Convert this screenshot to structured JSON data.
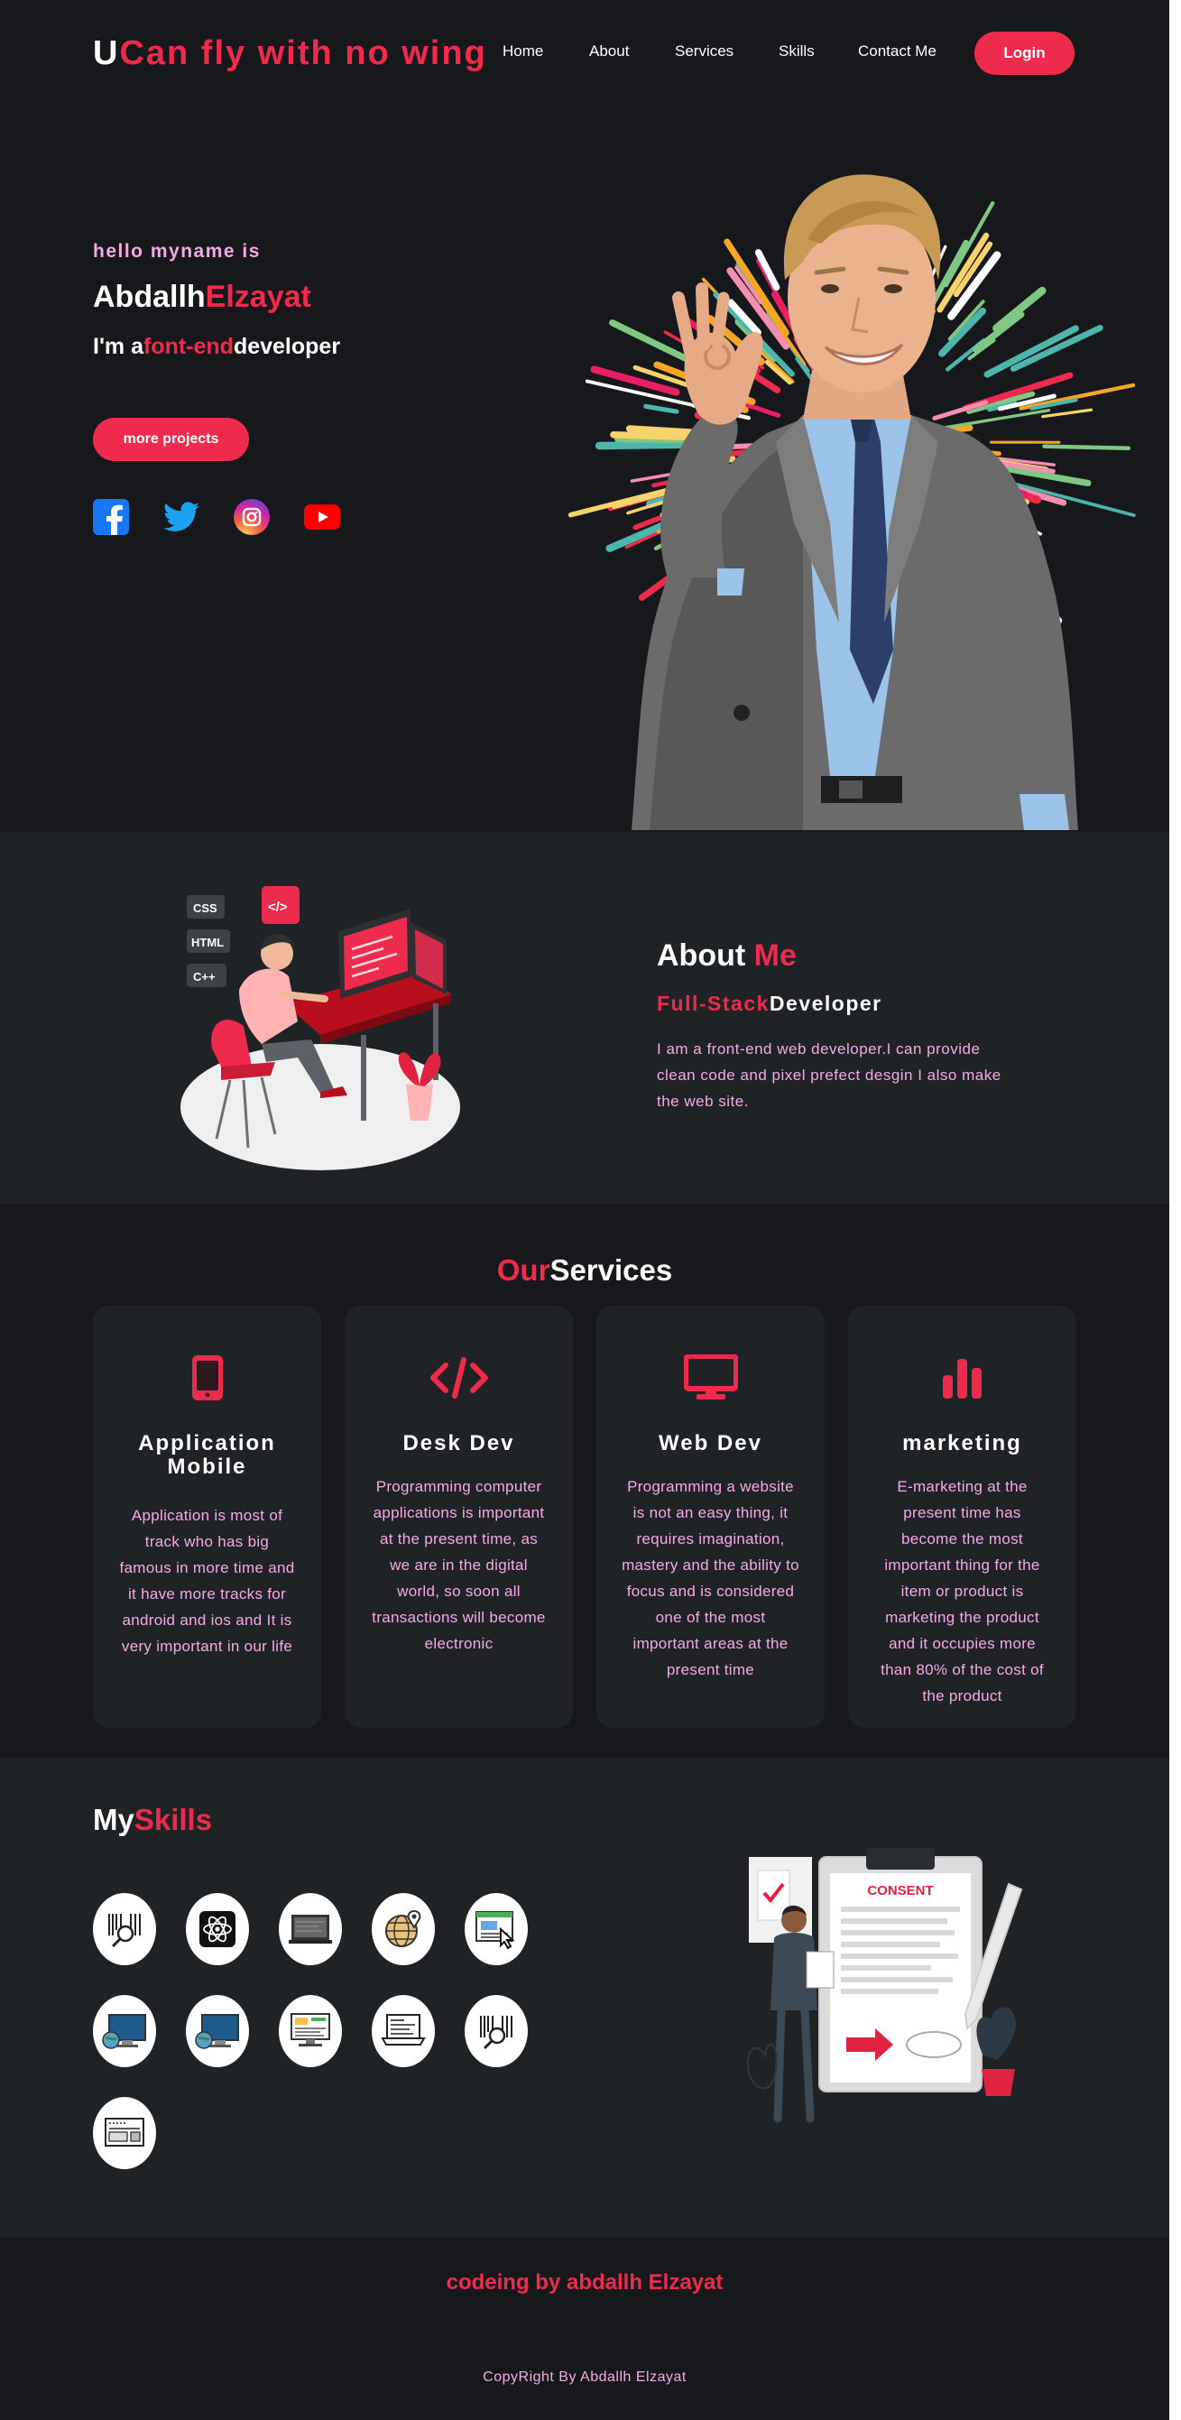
{
  "nav": {
    "logo_u": "U",
    "logo_rest": "Can fly with no wing",
    "links": [
      "Home",
      "About",
      "Services",
      "Skills",
      "Contact Me"
    ],
    "login_label": "Login"
  },
  "hero": {
    "hello": "hello myname is",
    "first_name": "Abdallh",
    "last_name": "Elzayat",
    "role_prefix": "I'm a",
    "role_highlight": "font-end",
    "role_suffix": "developer",
    "button_label": "more projects",
    "socials": [
      "facebook-icon",
      "twitter-icon",
      "instagram-icon",
      "youtube-icon"
    ]
  },
  "about": {
    "title_white": "About ",
    "title_red": "Me",
    "sub_red": "Full-Stack",
    "sub_white": "Developer",
    "text": "I am a front-end web developer.I can provide clean code and pixel prefect desgin I also make the web site.",
    "illustration_labels": [
      "CSS",
      "HTML",
      "C++",
      "</>"
    ]
  },
  "services": {
    "title_red": "Our",
    "title_white": "Services",
    "cards": [
      {
        "icon": "mobile-icon",
        "title": "Application Mobile",
        "text": "Application is most of track who has big famous in more time and it have more tracks for android and ios and It is very important in our life"
      },
      {
        "icon": "code-icon",
        "title": "Desk Dev",
        "text": "Programming computer applications is important at the present time, as we are in the digital world, so soon all transactions will become electronic"
      },
      {
        "icon": "desktop-icon",
        "title": "Web Dev",
        "text": "Programming a website is not an easy thing, it requires imagination, mastery and the ability to focus and is considered one of the most important areas at the present time"
      },
      {
        "icon": "chart-bar-icon",
        "title": "marketing",
        "text": "E-marketing at the present time has become the most important thing for the item or product is marketing the product and it occupies more than 80% of the cost of the product"
      }
    ]
  },
  "skills": {
    "title_white": "My",
    "title_red": "Skills",
    "icons": [
      "barcode-search-icon",
      "react-icon",
      "laptop-icon",
      "globe-pin-icon",
      "browser-cursor-icon",
      "monitor-globe-icon",
      "monitor-globe-icon",
      "monitor-chart-icon",
      "laptop-code-icon",
      "barcode-search-icon",
      "webpage-icon"
    ],
    "consent_label": "CONSENT"
  },
  "footer": {
    "title": "codeing by abdallh Elzayat",
    "copyright": "CopyRight By Abdallh Elzayat"
  },
  "colors": {
    "accent": "#ef2b4d",
    "background": "#16181b",
    "panel": "#202326",
    "pink_text": "#f5a9e6"
  }
}
